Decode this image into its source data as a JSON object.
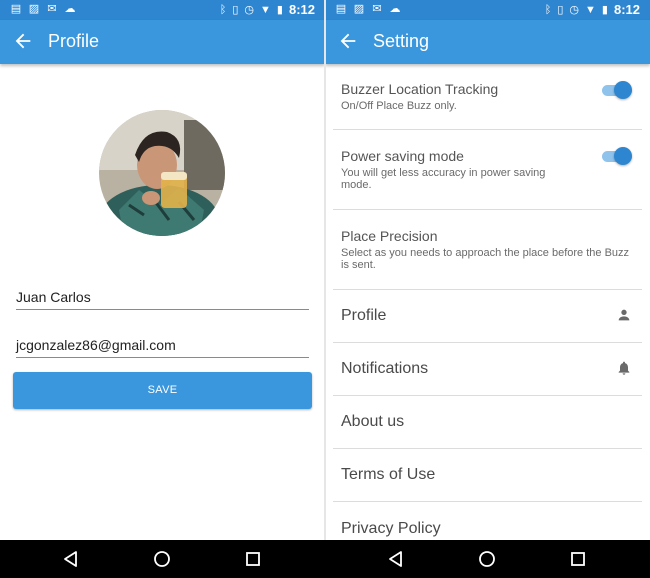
{
  "status_bar": {
    "time": "8:12",
    "left_icons": [
      "notification-icon",
      "image-icon",
      "mail-icon",
      "cloud-icon"
    ],
    "right_icons": [
      "bluetooth-icon",
      "vibrate-icon",
      "alarm-icon",
      "wifi-icon",
      "battery-icon"
    ]
  },
  "profile": {
    "title": "Profile",
    "name": "Juan Carlos",
    "email": "jcgonzalez86@gmail.com",
    "save_label": "SAVE"
  },
  "settings": {
    "title": "Setting",
    "toggles": [
      {
        "title": "Buzzer Location Tracking",
        "desc": "On/Off Place Buzz only.",
        "on": true
      },
      {
        "title": "Power saving mode",
        "desc": "You will get less accuracy in power saving mode.",
        "on": true
      }
    ],
    "precision": {
      "title": "Place Precision",
      "desc": "Select as you needs to approach the place before the Buzz is sent."
    },
    "items": [
      {
        "label": "Profile",
        "icon": "person-icon"
      },
      {
        "label": "Notifications",
        "icon": "bell-icon"
      },
      {
        "label": "About us"
      },
      {
        "label": "Terms of Use"
      },
      {
        "label": "Privacy Policy"
      }
    ]
  },
  "colors": {
    "app_bar": "#3a97dd",
    "status_bar": "#2e86d0",
    "toggle_thumb": "#2e86d0",
    "toggle_track": "#8fc3ec"
  }
}
